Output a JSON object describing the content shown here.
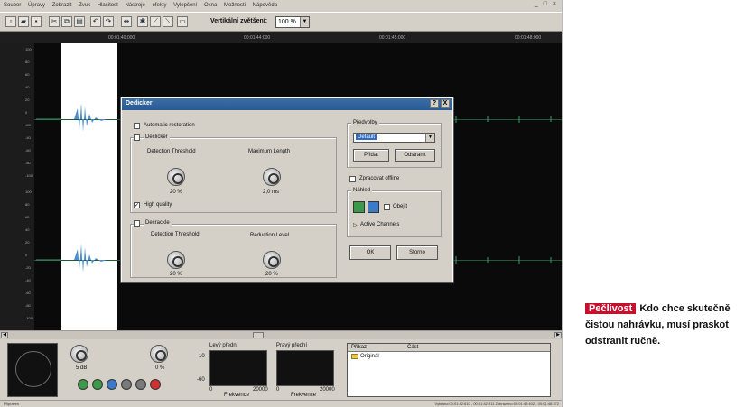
{
  "menu": [
    "Soubor",
    "Úpravy",
    "Zobrazit",
    "Zvuk",
    "Hlasitost",
    "Nástroje",
    "efekty",
    "Vylepšení",
    "Okna",
    "Možnosti",
    "Nápověda"
  ],
  "toolbar": {
    "zoom_label": "Vertikální zvětšení:",
    "zoom_value": "100 %"
  },
  "timeline": [
    "00:01:40:000",
    "00:01:44:000",
    "00:01:45:000",
    "00:01:48:000"
  ],
  "yaxis_ticks": [
    "100",
    "80",
    "60",
    "40",
    "20",
    "0",
    "-20",
    "-40",
    "-60",
    "-80",
    "-100",
    "100",
    "80",
    "60",
    "40",
    "20",
    "0",
    "-20",
    "-40",
    "-60",
    "-80",
    "-100"
  ],
  "dialog": {
    "title": "Dedicker",
    "title_buttons": [
      "?",
      "X"
    ],
    "automatic_restoration": "Automatic restoration",
    "declicker": "Declicker",
    "detection_threshold": "Detection Threshold",
    "maximum_length": "Maximum Length",
    "declicker_threshold_value": "20 %",
    "max_length_value": "2,0 ms",
    "high_quality": "High quality",
    "high_quality_check": "✓",
    "decrackle": "Decrackle",
    "decrackle_threshold_label": "Detection Threshold",
    "reduction_level_label": "Reduction Level",
    "decrackle_threshold_value": "20 %",
    "reduction_level_value": "20 %",
    "presets_label": "Předvolby",
    "preset_value": "Default",
    "add_button": "Přidat",
    "remove_button": "Odstranit",
    "offline_label": "Zpracovat offline",
    "preview_label": "Náhled",
    "bypass_label": "Obejít",
    "active_channels": "Active Channels",
    "ok_button": "OK",
    "cancel_button": "Storno"
  },
  "bottom": {
    "db_value": "5 dB",
    "pan_value": "0 %",
    "left_front": "Levý přední",
    "right_front": "Pravý přední",
    "spectrum_y_top": "-10",
    "spectrum_y_bottom": "-60",
    "spectrum_x_left": "0",
    "spectrum_x_right": "20000",
    "frequency_label": "Frekvence",
    "list_col_1": "Příkaz",
    "list_col_2": "Část",
    "list_item": "Originál"
  },
  "status": {
    "left": "Připraven",
    "right": "Vybráno:00:01:42:610 - 00:01:42:911   Zobrazeno:00:01:42:402 - 00:01:46:372"
  },
  "caption": {
    "highlight": "Pečlivost",
    "text": "Kdo chce skutečně čistou nahrávku, musí praskot odstranit ručně."
  },
  "colors": {
    "highlight": "#c8102e",
    "waveform": "#4a8fd0",
    "title_bar": "#3a6ea5"
  }
}
